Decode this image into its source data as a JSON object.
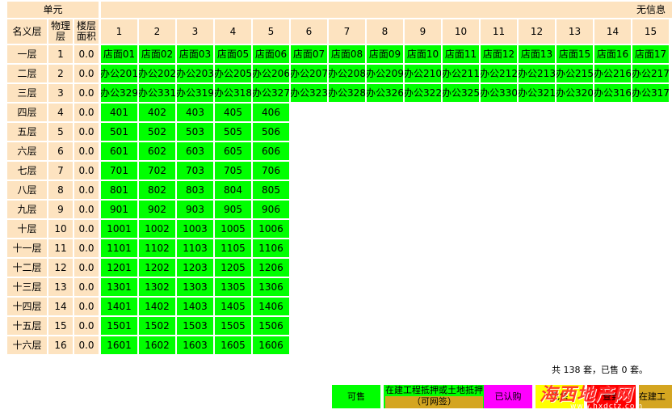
{
  "header": {
    "unit_label": "单元",
    "no_info": "无信息",
    "col_floor_name": "名义层",
    "col_physical": "物理层",
    "col_area": "楼层面积",
    "unit_numbers": [
      "1",
      "2",
      "3",
      "4",
      "5",
      "6",
      "7",
      "8",
      "9",
      "10",
      "11",
      "12",
      "13",
      "14",
      "15"
    ]
  },
  "floors": [
    {
      "name": "一层",
      "physical": "1",
      "area": "0.0",
      "rooms": [
        "店面01",
        "店面02",
        "店面03",
        "店面05",
        "店面06",
        "店面07",
        "店面08",
        "店面09",
        "店面10",
        "店面11",
        "店面12",
        "店面13",
        "店面15",
        "店面16",
        "店面17"
      ]
    },
    {
      "name": "二层",
      "physical": "2",
      "area": "0.0",
      "rooms": [
        "办公201",
        "办公202",
        "办公203",
        "办公205",
        "办公206",
        "办公207",
        "办公208",
        "办公209",
        "办公210",
        "办公211",
        "办公212",
        "办公213",
        "办公215",
        "办公216",
        "办公217"
      ]
    },
    {
      "name": "三层",
      "physical": "3",
      "area": "0.0",
      "rooms": [
        "办公329",
        "办公331",
        "办公319",
        "办公318",
        "办公327",
        "办公323",
        "办公328",
        "办公326",
        "办公322",
        "办公325",
        "办公330",
        "办公321",
        "办公320",
        "办公316",
        "办公317"
      ]
    },
    {
      "name": "四层",
      "physical": "4",
      "area": "0.0",
      "rooms": [
        "401",
        "402",
        "403",
        "405",
        "406"
      ]
    },
    {
      "name": "五层",
      "physical": "5",
      "area": "0.0",
      "rooms": [
        "501",
        "502",
        "503",
        "505",
        "506"
      ]
    },
    {
      "name": "六层",
      "physical": "6",
      "area": "0.0",
      "rooms": [
        "601",
        "602",
        "603",
        "605",
        "606"
      ]
    },
    {
      "name": "七层",
      "physical": "7",
      "area": "0.0",
      "rooms": [
        "701",
        "702",
        "703",
        "705",
        "706"
      ]
    },
    {
      "name": "八层",
      "physical": "8",
      "area": "0.0",
      "rooms": [
        "801",
        "802",
        "803",
        "804",
        "805"
      ]
    },
    {
      "name": "九层",
      "physical": "9",
      "area": "0.0",
      "rooms": [
        "901",
        "902",
        "903",
        "905",
        "906"
      ]
    },
    {
      "name": "十层",
      "physical": "10",
      "area": "0.0",
      "rooms": [
        "1001",
        "1002",
        "1003",
        "1005",
        "1006"
      ]
    },
    {
      "name": "十一层",
      "physical": "11",
      "area": "0.0",
      "rooms": [
        "1101",
        "1102",
        "1103",
        "1105",
        "1106"
      ]
    },
    {
      "name": "十二层",
      "physical": "12",
      "area": "0.0",
      "rooms": [
        "1201",
        "1202",
        "1203",
        "1205",
        "1206"
      ]
    },
    {
      "name": "十三层",
      "physical": "13",
      "area": "0.0",
      "rooms": [
        "1301",
        "1302",
        "1303",
        "1305",
        "1306"
      ]
    },
    {
      "name": "十四层",
      "physical": "14",
      "area": "0.0",
      "rooms": [
        "1401",
        "1402",
        "1403",
        "1405",
        "1406"
      ]
    },
    {
      "name": "十五层",
      "physical": "15",
      "area": "0.0",
      "rooms": [
        "1501",
        "1502",
        "1503",
        "1505",
        "1506"
      ]
    },
    {
      "name": "十六层",
      "physical": "16",
      "area": "0.0",
      "rooms": [
        "1601",
        "1602",
        "1603",
        "1605",
        "1606"
      ]
    }
  ],
  "stats": "共 138 套，已售 0 套。",
  "legend": [
    {
      "label": "可售",
      "color": "#00ff00"
    },
    {
      "label": "在建工程抵押或土地抵押（可网签）",
      "color": "#00ff00"
    },
    {
      "label": "已认购",
      "color": "#ff00ff"
    },
    {
      "label": "已售",
      "color": "#ffff00"
    },
    {
      "label": "查封",
      "color": "#ff0000"
    },
    {
      "label": "在建工",
      "color": "#d4a520"
    }
  ],
  "watermark": {
    "text": "海西地产网",
    "url": "www.hxdctz.com"
  },
  "colors": {
    "header_bg": "#fde3c0",
    "available": "#00ff00"
  }
}
